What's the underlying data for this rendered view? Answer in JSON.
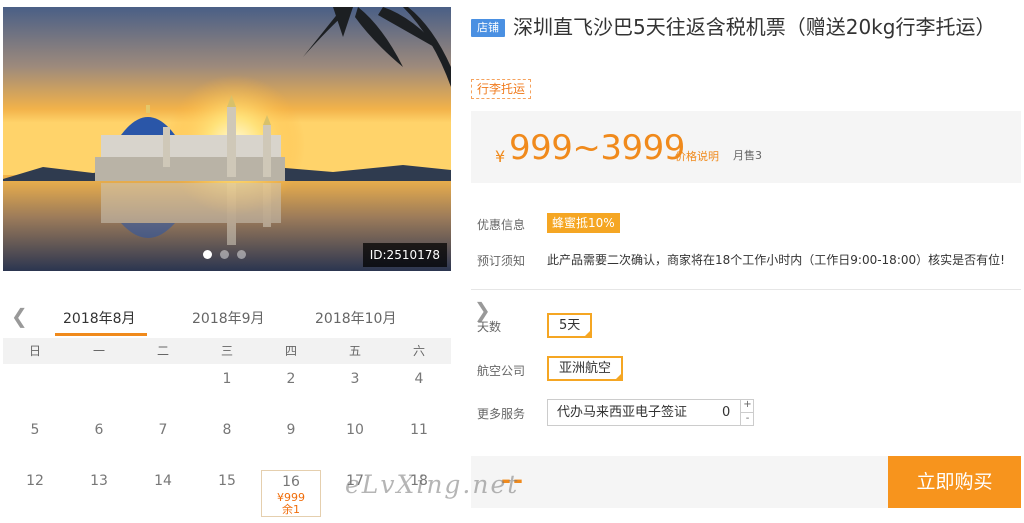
{
  "hero": {
    "id_label": "ID:2510178",
    "dots": 3,
    "active_dot": 0
  },
  "calendar": {
    "prev_icon": "chevron-left-icon",
    "next_icon": "chevron-right-icon",
    "months": [
      "2018年8月",
      "2018年9月",
      "2018年10月"
    ],
    "selected_month": 0,
    "weekdays": [
      "日",
      "一",
      "二",
      "三",
      "四",
      "五",
      "六"
    ],
    "rows": [
      [
        "",
        "",
        "",
        "1",
        "2",
        "3",
        "4"
      ],
      [
        "5",
        "6",
        "7",
        "8",
        "9",
        "10",
        "11"
      ],
      [
        "12",
        "13",
        "14",
        "15",
        "16",
        "17",
        "18"
      ]
    ],
    "special": {
      "day": "16",
      "price": "¥999",
      "remaining": "余1"
    }
  },
  "product": {
    "shop_badge": "店铺",
    "title": "深圳直飞沙巴5天往返含税机票（赠送20kg行李托运）",
    "tag": "行李托运",
    "price_symbol": "¥",
    "price_range": "999~3999",
    "price_note": "价格说明",
    "sold": "月售3",
    "promo_label": "优惠信息",
    "promo_badge": "蜂蜜抵10%",
    "notice_label": "预订须知",
    "notice_text": "此产品需要二次确认，商家将在18个工作小时内（工作日9:00-18:00）核实是否有位!",
    "days_label": "天数",
    "days_option": "5天",
    "airline_label": "航空公司",
    "airline_option": "亚洲航空",
    "more_label": "更多服务",
    "service_name": "代办马来西亚电子签证",
    "service_qty": "0",
    "plus": "+",
    "minus": "-",
    "total_placeholder": "--",
    "buy_label": "立即购买"
  },
  "watermark": "eLvXing.net",
  "colors": {
    "accent": "#f08a1c",
    "buy": "#f7941d",
    "shop_badge": "#4a90e2"
  }
}
